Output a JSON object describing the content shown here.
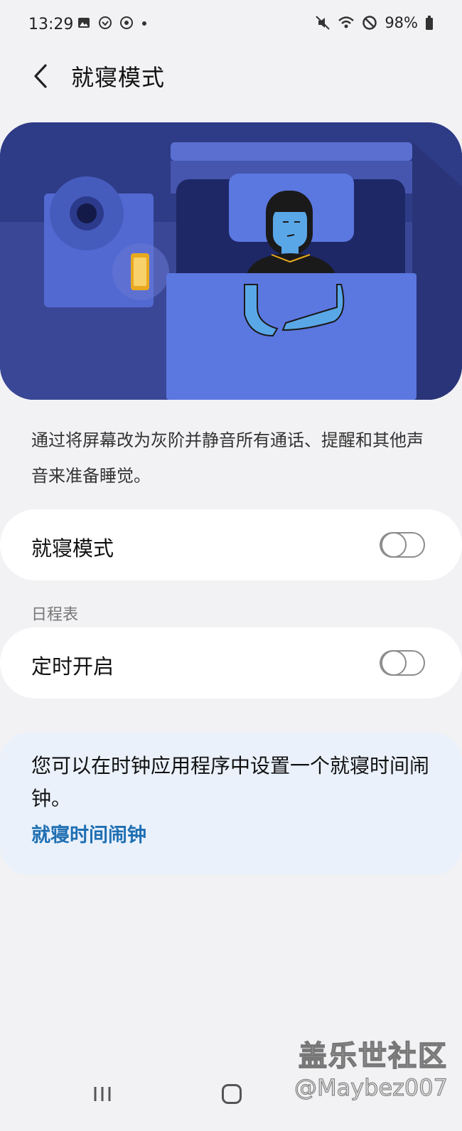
{
  "status_bar": {
    "time": "13:29",
    "battery": "98%",
    "left_icons": [
      "gallery-icon",
      "messenger-icon",
      "sync-app-icon",
      "dot-icon"
    ],
    "right_icons": [
      "mute-icon",
      "wifi-icon",
      "do-not-disturb-icon",
      "battery-icon"
    ]
  },
  "header": {
    "back_icon": "chevron-left-icon",
    "title": "就寝模式"
  },
  "description": "通过将屏幕改为灰阶并静音所有通话、提醒和其他声音来准备睡觉。",
  "bedtime_toggle": {
    "label": "就寝模式",
    "on": false
  },
  "schedule": {
    "section_label": "日程表",
    "label": "定时开启",
    "on": false
  },
  "info_card": {
    "text": "您可以在时钟应用程序中设置一个就寝时间闹钟。",
    "link": "就寝时间闹钟"
  },
  "nav_bar": {
    "buttons": [
      "recent-apps-icon",
      "home-icon"
    ]
  },
  "watermark": {
    "line1": "盖乐世社区",
    "line2": "@Maybez007"
  },
  "colors": {
    "background": "#f2f2f4",
    "illustration_bg": "#2e3b86",
    "link": "#1f6fb2",
    "info_bg": "#eaf1fb"
  }
}
